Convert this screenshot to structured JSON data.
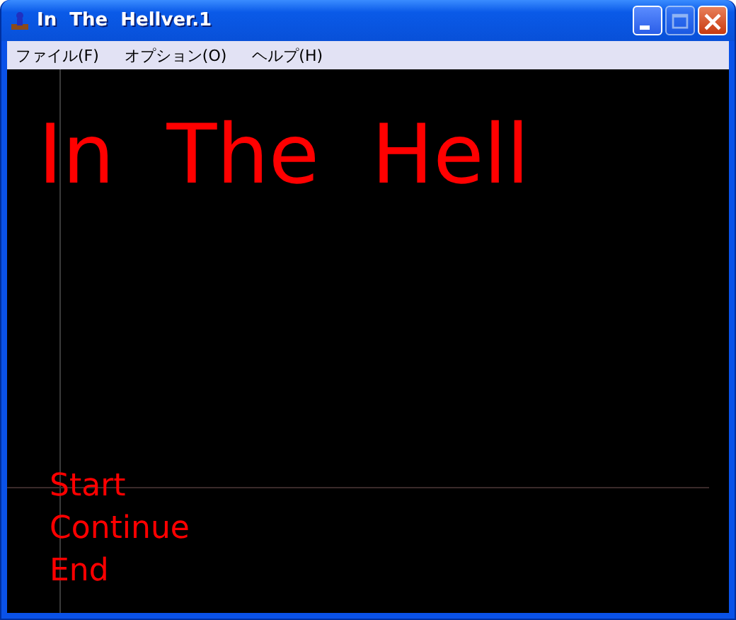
{
  "window": {
    "title": "In  The  Hellver.1",
    "buttons": [
      {
        "kind": "minimize",
        "disabled": false
      },
      {
        "kind": "maximize",
        "disabled": true
      },
      {
        "kind": "close",
        "disabled": false
      }
    ]
  },
  "menu": [
    "ファイル(F)",
    "オプション(O)",
    "ヘルプ(H)"
  ],
  "game": {
    "title": "In  The  Hell",
    "options": [
      {
        "label": "Start"
      },
      {
        "label": "Continue"
      },
      {
        "label": "End"
      }
    ]
  }
}
